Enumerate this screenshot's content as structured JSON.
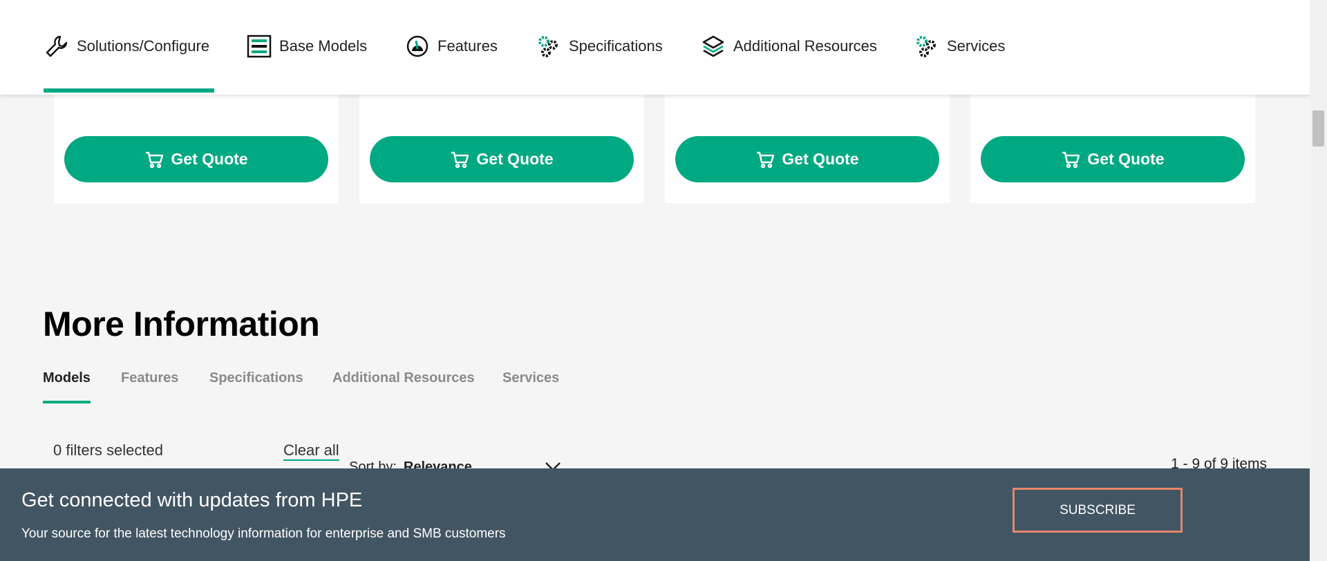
{
  "nav": {
    "items": [
      {
        "label": "Solutions/Configure",
        "icon": "wrench-icon",
        "active": true
      },
      {
        "label": "Base Models",
        "icon": "server-rack-icon"
      },
      {
        "label": "Features",
        "icon": "gauge-icon"
      },
      {
        "label": "Specifications",
        "icon": "gears-icon"
      },
      {
        "label": "Additional Resources",
        "icon": "layers-icon"
      },
      {
        "label": "Services",
        "icon": "gears-icon"
      }
    ],
    "accent_color": "#01a982"
  },
  "cards": [
    {
      "button_label": "Get Quote",
      "icon": "cart-icon"
    },
    {
      "button_label": "Get Quote",
      "icon": "cart-icon"
    },
    {
      "button_label": "Get Quote",
      "icon": "cart-icon"
    },
    {
      "button_label": "Get Quote",
      "icon": "cart-icon"
    }
  ],
  "more_info": {
    "title": "More Information",
    "tabs": [
      "Models",
      "Features",
      "Specifications",
      "Additional Resources",
      "Services"
    ],
    "active_tab": "Models",
    "filters_selected": "0 filters selected",
    "clear_all": "Clear all",
    "sort_label": "Sort by:",
    "sort_value": "Relevance",
    "items_count": "1 - 9 of 9 items"
  },
  "banner": {
    "title": "Get connected with updates from HPE",
    "subtitle": "Your source for the latest technology information for enterprise and SMB customers",
    "subscribe_label": "SUBSCRIBE",
    "background_color": "#425563",
    "button_border_color": "#e8866a"
  }
}
